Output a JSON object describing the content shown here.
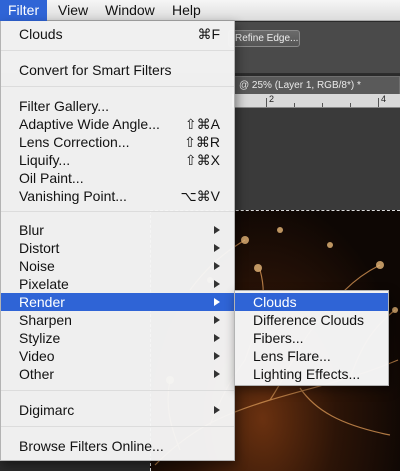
{
  "menubar": {
    "items": [
      {
        "label": "Filter",
        "active": true
      },
      {
        "label": "View"
      },
      {
        "label": "Window"
      },
      {
        "label": "Help"
      }
    ]
  },
  "options_bar": {
    "refine_edge_label": "Refine Edge..."
  },
  "document": {
    "tab_title": "@ 25% (Layer 1, RGB/8*) *",
    "ruler_labels": [
      "2",
      "4"
    ]
  },
  "filter_menu": {
    "items": [
      {
        "label": "Clouds",
        "shortcut": "⌘F"
      },
      {
        "label": "Convert for Smart Filters"
      },
      {
        "label": "Filter Gallery..."
      },
      {
        "label": "Adaptive Wide Angle...",
        "shortcut": "⇧⌘A"
      },
      {
        "label": "Lens Correction...",
        "shortcut": "⇧⌘R"
      },
      {
        "label": "Liquify...",
        "shortcut": "⇧⌘X"
      },
      {
        "label": "Oil Paint..."
      },
      {
        "label": "Vanishing Point...",
        "shortcut": "⌥⌘V"
      },
      {
        "label": "Blur",
        "submenu": true
      },
      {
        "label": "Distort",
        "submenu": true
      },
      {
        "label": "Noise",
        "submenu": true
      },
      {
        "label": "Pixelate",
        "submenu": true
      },
      {
        "label": "Render",
        "submenu": true,
        "highlighted": true
      },
      {
        "label": "Sharpen",
        "submenu": true
      },
      {
        "label": "Stylize",
        "submenu": true
      },
      {
        "label": "Video",
        "submenu": true
      },
      {
        "label": "Other",
        "submenu": true
      },
      {
        "label": "Digimarc",
        "submenu": true
      },
      {
        "label": "Browse Filters Online..."
      }
    ]
  },
  "render_submenu": {
    "items": [
      {
        "label": "Clouds",
        "highlighted": true
      },
      {
        "label": "Difference Clouds"
      },
      {
        "label": "Fibers..."
      },
      {
        "label": "Lens Flare..."
      },
      {
        "label": "Lighting Effects..."
      }
    ]
  },
  "colors": {
    "highlight": "#2f64d6",
    "menu_bg": "#f6f6f6"
  }
}
